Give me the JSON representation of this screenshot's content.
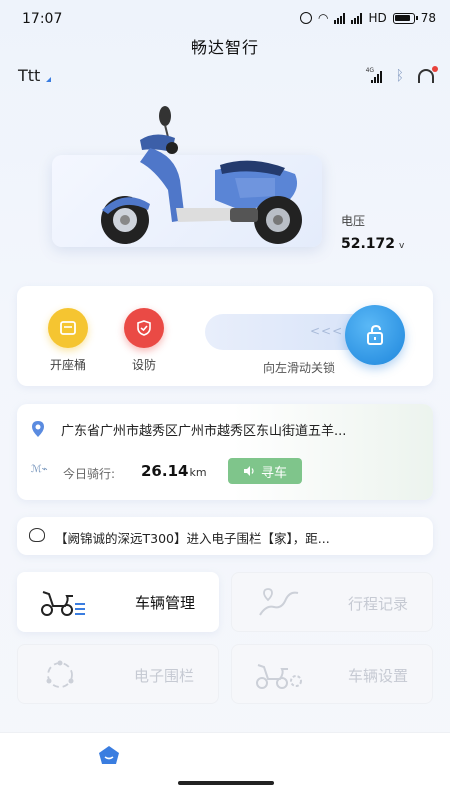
{
  "status_bar": {
    "time": "17:07",
    "hd": "HD",
    "battery": "78"
  },
  "app": {
    "title": "畅达智行"
  },
  "user": {
    "name": "Ttt"
  },
  "voltage": {
    "label": "电压",
    "value": "52.172",
    "unit": "v"
  },
  "controls": {
    "seat_label": "开座桶",
    "arm_label": "设防",
    "slider_label": "向左滑动关锁",
    "slider_arrows": "<<<"
  },
  "location": {
    "address": "广东省广州市越秀区广州市越秀区东山街道五羊...",
    "ride_label": "今日骑行:",
    "ride_value": "26.14",
    "ride_unit": "km",
    "find_label": "寻车"
  },
  "notice": {
    "text": "【阙锦诚的深远T300】进入电子围栏【家】，距..."
  },
  "menu": {
    "vehicle_manage": "车辆管理",
    "trip_record": "行程记录",
    "geofence": "电子围栏",
    "vehicle_settings": "车辆设置"
  },
  "colors": {
    "accent": "#1e86dc",
    "find_button": "#7fc58b",
    "seat_button": "#f5c531",
    "arm_button": "#ea4a45"
  }
}
